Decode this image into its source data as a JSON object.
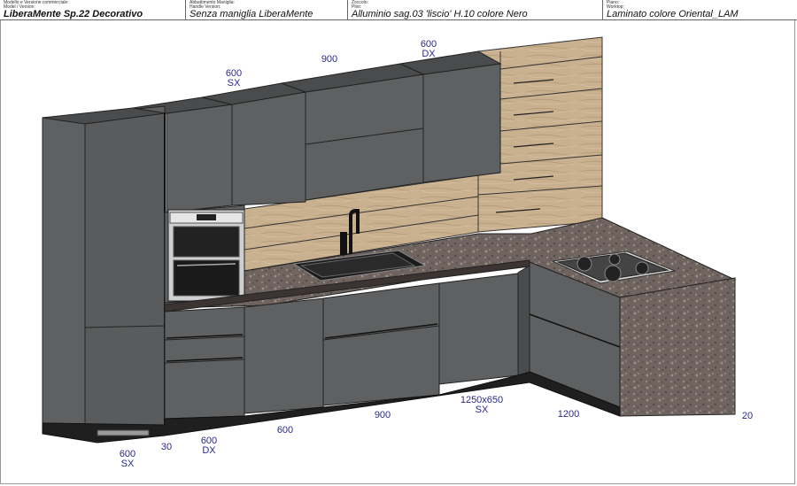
{
  "header": {
    "cells": [
      {
        "lbl1": "Modello e Versione commerciale:",
        "lbl2": "Model / Version:",
        "value": "LiberaMente Sp.22 Decorativo",
        "bold": true
      },
      {
        "lbl1": "Abbattimento Maniglia:",
        "lbl2": "Handle Version:",
        "value": "Senza maniglia LiberaMente",
        "bold": false
      },
      {
        "lbl1": "Zoccolo:",
        "lbl2": "Plint:",
        "value": "Alluminio sag.03 'liscio' H.10 colore Nero",
        "bold": false
      },
      {
        "lbl1": "Piano:",
        "lbl2": "Worktop:",
        "value": "Laminato colore Oriental_LAM",
        "bold": false
      }
    ]
  },
  "dimensions": {
    "wall_600_sx": {
      "v": "600",
      "s": "SX"
    },
    "wall_900": {
      "v": "900"
    },
    "wall_600_dx": {
      "v": "600",
      "s": "DX"
    },
    "base_600_sx": {
      "v": "600",
      "s": "SX"
    },
    "base_30": {
      "v": "30"
    },
    "base_600_dx": {
      "v": "600",
      "s": "DX"
    },
    "base_600": {
      "v": "600"
    },
    "base_900": {
      "v": "900"
    },
    "corner_1250": {
      "v": "1250x650",
      "s": "SX"
    },
    "base_1200": {
      "v": "1200"
    },
    "side_20": {
      "v": "20"
    }
  },
  "colors": {
    "cabinet": "#5f6061",
    "cabinet_dark": "#4a4b4c",
    "wood": "#c9b08e",
    "worktop": "#6f6460",
    "plinth": "#1f1f1f",
    "dimension_text": "#2a2a8c"
  }
}
